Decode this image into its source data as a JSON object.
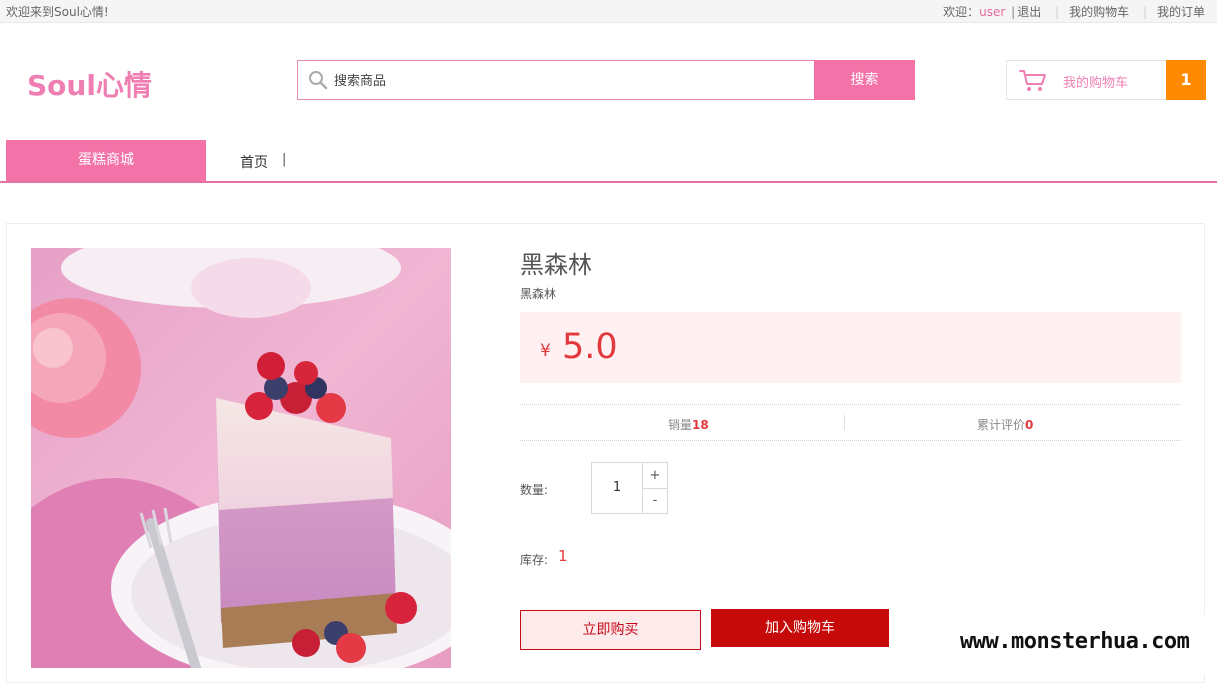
{
  "topbar": {
    "welcome_text": "欢迎来到Soul心情!",
    "greeting": "欢迎：",
    "username": "user",
    "divider": "|",
    "logout": "退出",
    "my_cart": "我的购物车",
    "my_orders": "我的订单"
  },
  "header": {
    "logo_text": "Soul心情",
    "search_placeholder": "搜索商品",
    "search_button": "搜索",
    "cart_label": "我的购物车",
    "cart_count": "1"
  },
  "nav": {
    "category": "蛋糕商城",
    "home": "首页",
    "divider": "|"
  },
  "product": {
    "name": "黑森林",
    "subtitle": "黑森林",
    "currency": "¥",
    "price": "5.0",
    "sales_label": "销量",
    "sales_value": "18",
    "reviews_label": "累计评价",
    "reviews_value": "0",
    "quantity_label": "数量:",
    "quantity": "1",
    "plus": "+",
    "minus": "-",
    "stock_label": "库存:",
    "stock_value": "1",
    "buy_now": "立即购买",
    "add_to_cart": "加入购物车"
  },
  "watermark": "www.monsterhua.com",
  "colors": {
    "brand_pink": "#f372a8",
    "price_red": "#e4393c",
    "cart_orange": "#ff8a00",
    "add_cart_red": "#c60a0a"
  }
}
